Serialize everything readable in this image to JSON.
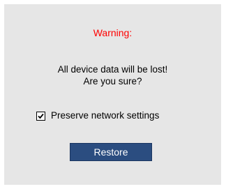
{
  "dialog": {
    "warning_title": "Warning:",
    "message_line1": "All device data will be lost!",
    "message_line2": "Are you sure?",
    "preserve_checkbox": {
      "label": "Preserve network settings",
      "checked": true
    },
    "restore_label": "Restore"
  },
  "colors": {
    "panel_background": "#e6e6e6",
    "warning_text": "#ff0000",
    "button_background": "#2b4d80",
    "button_text": "#ffffff"
  },
  "icons": {
    "checkbox_mark": "check-icon"
  }
}
